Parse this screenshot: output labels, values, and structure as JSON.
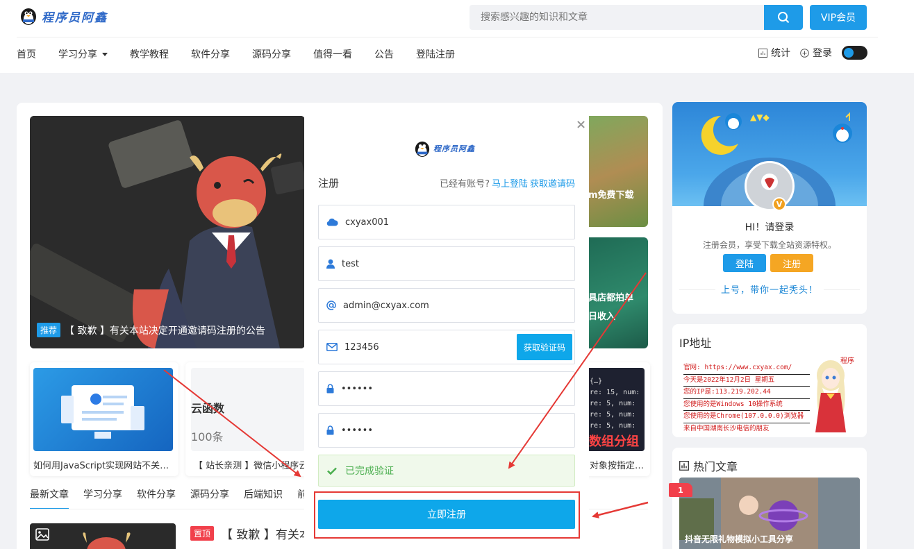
{
  "header": {
    "logo_text": "程序员阿鑫",
    "search_placeholder": "搜索感兴趣的知识和文章",
    "vip_label": "VIP会员"
  },
  "nav": {
    "items": [
      {
        "label": "首页"
      },
      {
        "label": "学习分享",
        "has_dropdown": true
      },
      {
        "label": "教学教程"
      },
      {
        "label": "软件分享"
      },
      {
        "label": "源码分享"
      },
      {
        "label": "值得一看"
      },
      {
        "label": "公告"
      },
      {
        "label": "登陆注册"
      }
    ],
    "stats_label": "统计",
    "login_label": "登录"
  },
  "hero": {
    "tag": "推荐",
    "caption": "【 致歉 】有关本站决定开通邀请码注册的公告",
    "side1_text": "m免费下载",
    "side2_lines": [
      "具店都拍单",
      "日收入"
    ]
  },
  "mini_cards": [
    {
      "text": "如何用JavaScript实现网站不关…"
    },
    {
      "text": "【 站长亲测 】微信小程序云开",
      "img_lines": [
        "云函数",
        "100条"
      ]
    },
    {
      "text": "对象按指定…",
      "img_text": "数组分组"
    }
  ],
  "tabs": [
    {
      "label": "最新文章",
      "active": true
    },
    {
      "label": "学习分享"
    },
    {
      "label": "软件分享"
    },
    {
      "label": "源码分享"
    },
    {
      "label": "后端知识"
    },
    {
      "label": "前"
    }
  ],
  "post": {
    "tag": "置顶",
    "title": "【 致歉 】有关本"
  },
  "profile": {
    "greeting": "HI！请登录",
    "subtitle": "注册会员，享受下载全站资源特权。",
    "login_btn": "登陆",
    "register_btn": "注册",
    "slogan": "上号，带你一起秃头！",
    "badge": "V"
  },
  "ip_card": {
    "title": "IP地址",
    "lines": [
      "官网: https://www.cxyax.com/",
      "今天是2022年12月2日 星期五",
      "您的IP是:113.219.202.44",
      "您使用的是Windows 10操作系统",
      "您使用的是Chrome(107.0.0.0)浏览器",
      "来自中国湖南长沙电信的朋友"
    ],
    "side_text": "程序"
  },
  "hot": {
    "title": "热门文章",
    "rank": "1",
    "caption": "抖音无限礼物模拟小工具分享"
  },
  "modal": {
    "close": "×",
    "logo_text": "程序员阿鑫",
    "title": "注册",
    "has_account": "已经有账号?",
    "login_now": "马上登陆",
    "get_invite": "获取邀请码",
    "fields": {
      "invite": "cxyax001",
      "username": "test",
      "email": "admin@cxyax.com",
      "code": "123456",
      "password": "••••••",
      "password_confirm": "••••••"
    },
    "get_code_btn": "获取验证码",
    "verified": "已完成验证",
    "submit": "立即注册"
  },
  "colors": {
    "accent": "#0ea7ea",
    "nav_accent": "#1e9be8",
    "annotation_red": "#e53935",
    "orange": "#f5a623",
    "success": "#4caf50"
  }
}
